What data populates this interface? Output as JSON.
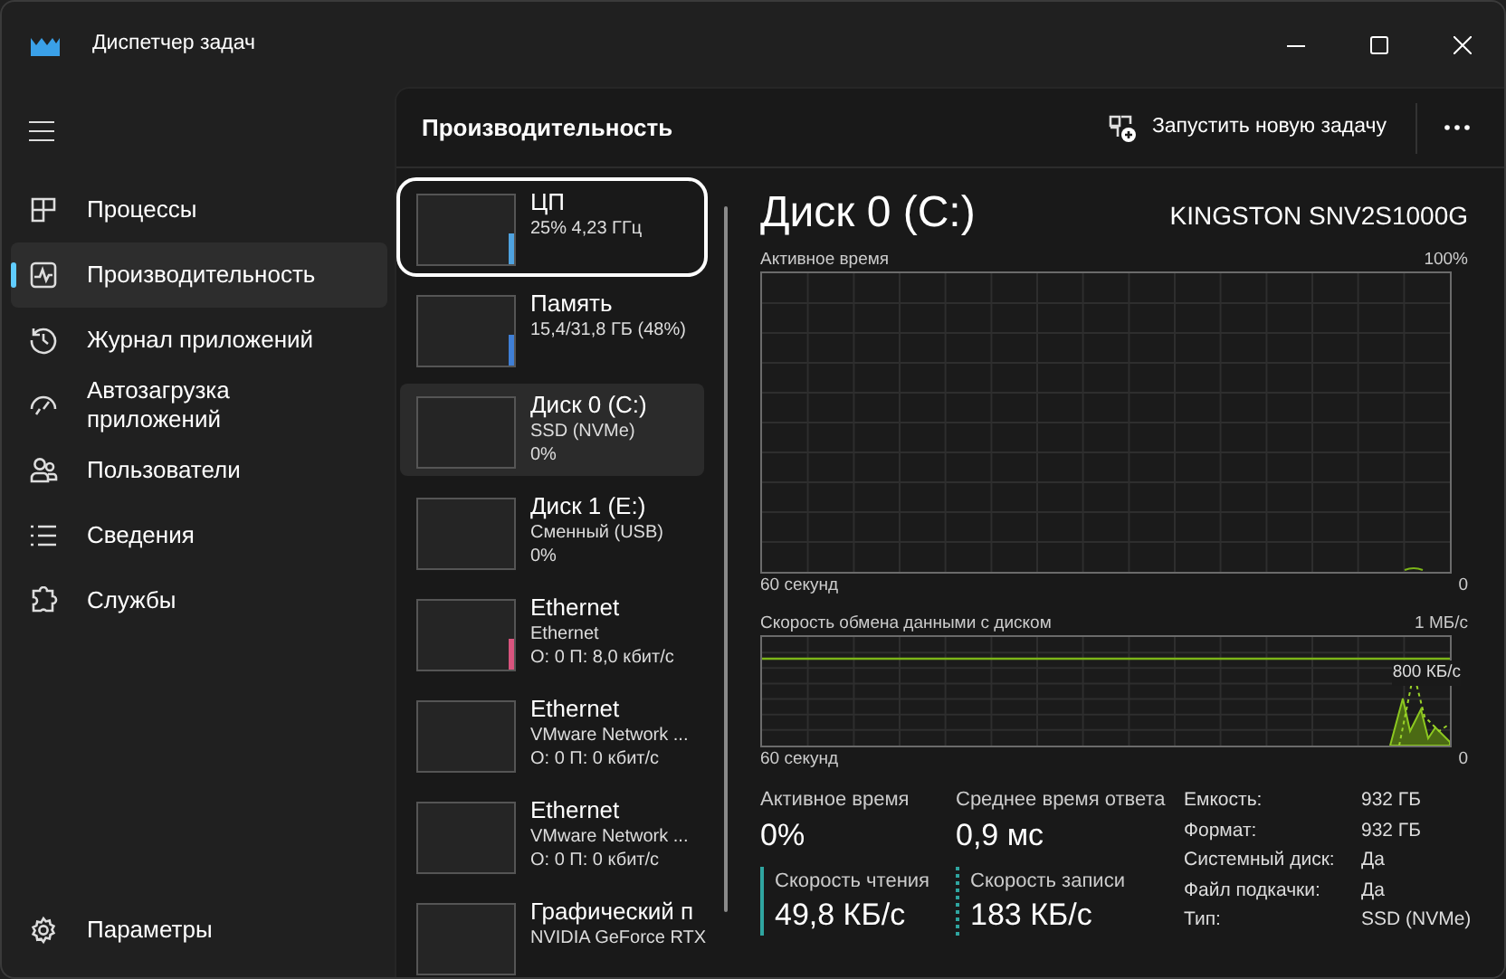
{
  "window": {
    "title": "Диспетчер задач"
  },
  "nav": {
    "items": [
      {
        "label": "Процессы",
        "selected": false
      },
      {
        "label": "Производительность",
        "selected": true
      },
      {
        "label": "Журнал приложений",
        "selected": false
      },
      {
        "label": "Автозагрузка приложений",
        "selected": false
      },
      {
        "label": "Пользователи",
        "selected": false
      },
      {
        "label": "Сведения",
        "selected": false
      },
      {
        "label": "Службы",
        "selected": false
      }
    ],
    "settings": "Параметры"
  },
  "header": {
    "title": "Производительность",
    "run_task": "Запустить новую задачу"
  },
  "devices": [
    {
      "name": "ЦП",
      "lines": [
        "25% 4,23 ГГц"
      ],
      "selected": false,
      "highlighted": true,
      "color": "#4fa3e0"
    },
    {
      "name": "Память",
      "lines": [
        "15,4/31,8 ГБ (48%)"
      ],
      "selected": false,
      "highlighted": false,
      "color": "#3f7fd6"
    },
    {
      "name": "Диск 0 (C:)",
      "lines": [
        "SSD (NVMe)",
        "0%"
      ],
      "selected": true,
      "highlighted": false
    },
    {
      "name": "Диск 1 (E:)",
      "lines": [
        "Сменный (USB)",
        "0%"
      ],
      "selected": false,
      "highlighted": false
    },
    {
      "name": "Ethernet",
      "lines": [
        "Ethernet",
        "О: 0 П: 8,0 кбит/с"
      ],
      "selected": false,
      "highlighted": false,
      "color": "#d9547e"
    },
    {
      "name": "Ethernet",
      "lines": [
        "VMware Network ...",
        "О: 0 П: 0 кбит/с"
      ],
      "selected": false,
      "highlighted": false
    },
    {
      "name": "Ethernet",
      "lines": [
        "VMware Network ...",
        "О: 0 П: 0 кбит/с"
      ],
      "selected": false,
      "highlighted": false
    },
    {
      "name": "Графический п",
      "lines": [
        "NVIDIA GeForce RTX"
      ],
      "selected": false,
      "highlighted": false
    }
  ],
  "detail": {
    "title": "Диск 0 (C:)",
    "model": "KINGSTON SNV2S1000G",
    "graphs": [
      {
        "kind": "active_time",
        "label": "Активное время",
        "max": "100%",
        "time": "60 секунд",
        "min": "0"
      },
      {
        "kind": "transfer_rate",
        "label": "Скорость обмена данными с диском",
        "max": "1 МБ/с",
        "overlay": "800 КБ/с",
        "time": "60 секунд",
        "min": "0"
      }
    ],
    "stats": [
      {
        "kind": "plain",
        "label": "Активное время",
        "value": "0%"
      },
      {
        "kind": "plain",
        "label": "Среднее время ответа",
        "value": "0,9 мс"
      },
      {
        "kind": "read",
        "label": "Скорость чтения",
        "value": "49,8 КБ/с"
      },
      {
        "kind": "write",
        "label": "Скорость записи",
        "value": "183 КБ/с"
      }
    ],
    "properties": [
      {
        "label": "Емкость:",
        "value": "932 ГБ"
      },
      {
        "label": "Формат:",
        "value": "932 ГБ"
      },
      {
        "label": "Системный диск:",
        "value": "Да"
      },
      {
        "label": "Файл подкачки:",
        "value": "Да"
      },
      {
        "label": "Тип:",
        "value": "SSD (NVMe)"
      }
    ]
  }
}
